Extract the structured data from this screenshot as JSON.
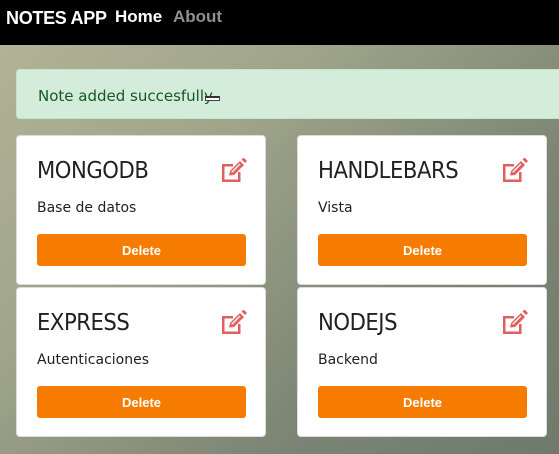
{
  "navbar": {
    "brand": "NOTES APP",
    "links": [
      {
        "label": "Home"
      },
      {
        "label": "About"
      }
    ]
  },
  "alert": {
    "message": "Note added succesfully"
  },
  "notes": [
    {
      "title": "MONGODB",
      "description": "Base de datos",
      "delete_label": "Delete"
    },
    {
      "title": "HANDLEBARS",
      "description": "Vista",
      "delete_label": "Delete"
    },
    {
      "title": "EXPRESS",
      "description": "Autenticaciones",
      "delete_label": "Delete"
    },
    {
      "title": "NODEJS",
      "description": "Backend",
      "delete_label": "Delete"
    }
  ],
  "colors": {
    "navbar_bg": "#000000",
    "alert_bg": "#d4edda",
    "alert_text": "#155724",
    "delete_button": "#f57c00",
    "edit_icon": "#e05f5f"
  },
  "icons": {
    "edit": "edit-icon",
    "alert_close": "close-icon"
  }
}
